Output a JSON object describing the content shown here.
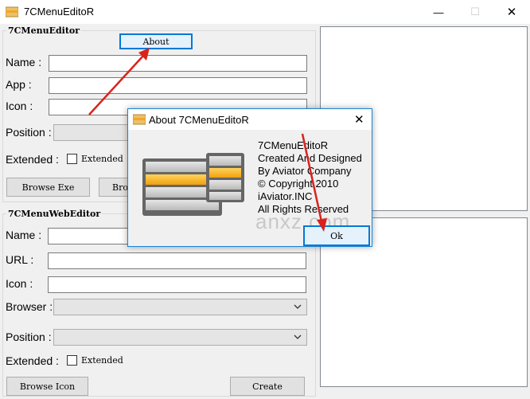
{
  "window": {
    "title": "7CMenuEditoR",
    "minimize_glyph": "—",
    "maximize_glyph": "☐",
    "close_glyph": "✕",
    "icon": "folder-icon"
  },
  "menu_editor": {
    "group_title": "7CMenuEditor",
    "about_label": "About",
    "name_label": "Name :",
    "app_label": "App :",
    "icon_label": "Icon :",
    "position_label": "Position :",
    "extended_label": "Extended :",
    "extended_check_label": "Extended",
    "browse_exe_label": "Browse Exe",
    "browse_other_label": "Bro"
  },
  "web_editor": {
    "group_title": "7CMenuWebEditor",
    "name_label": "Name :",
    "url_label": "URL :",
    "icon_label": "Icon :",
    "browser_label": "Browser :",
    "position_label": "Position :",
    "extended_label": "Extended :",
    "extended_check_label": "Extended",
    "browse_icon_label": "Browse Icon",
    "create_label": "Create"
  },
  "about_dialog": {
    "title": "About 7CMenuEditoR",
    "close_glyph": "✕",
    "lines": [
      "7CMenuEditoR",
      "Created And Designed",
      "By Aviator Company",
      "© Copyright 2010",
      "iAviator.INC",
      "All Rights Reserved"
    ],
    "ok_label": "Ok",
    "watermark": "anxz.com"
  },
  "colors": {
    "accent_blue": "#0078d7",
    "annotation_red": "#d9221c",
    "logo_orange": "#f5a623"
  }
}
